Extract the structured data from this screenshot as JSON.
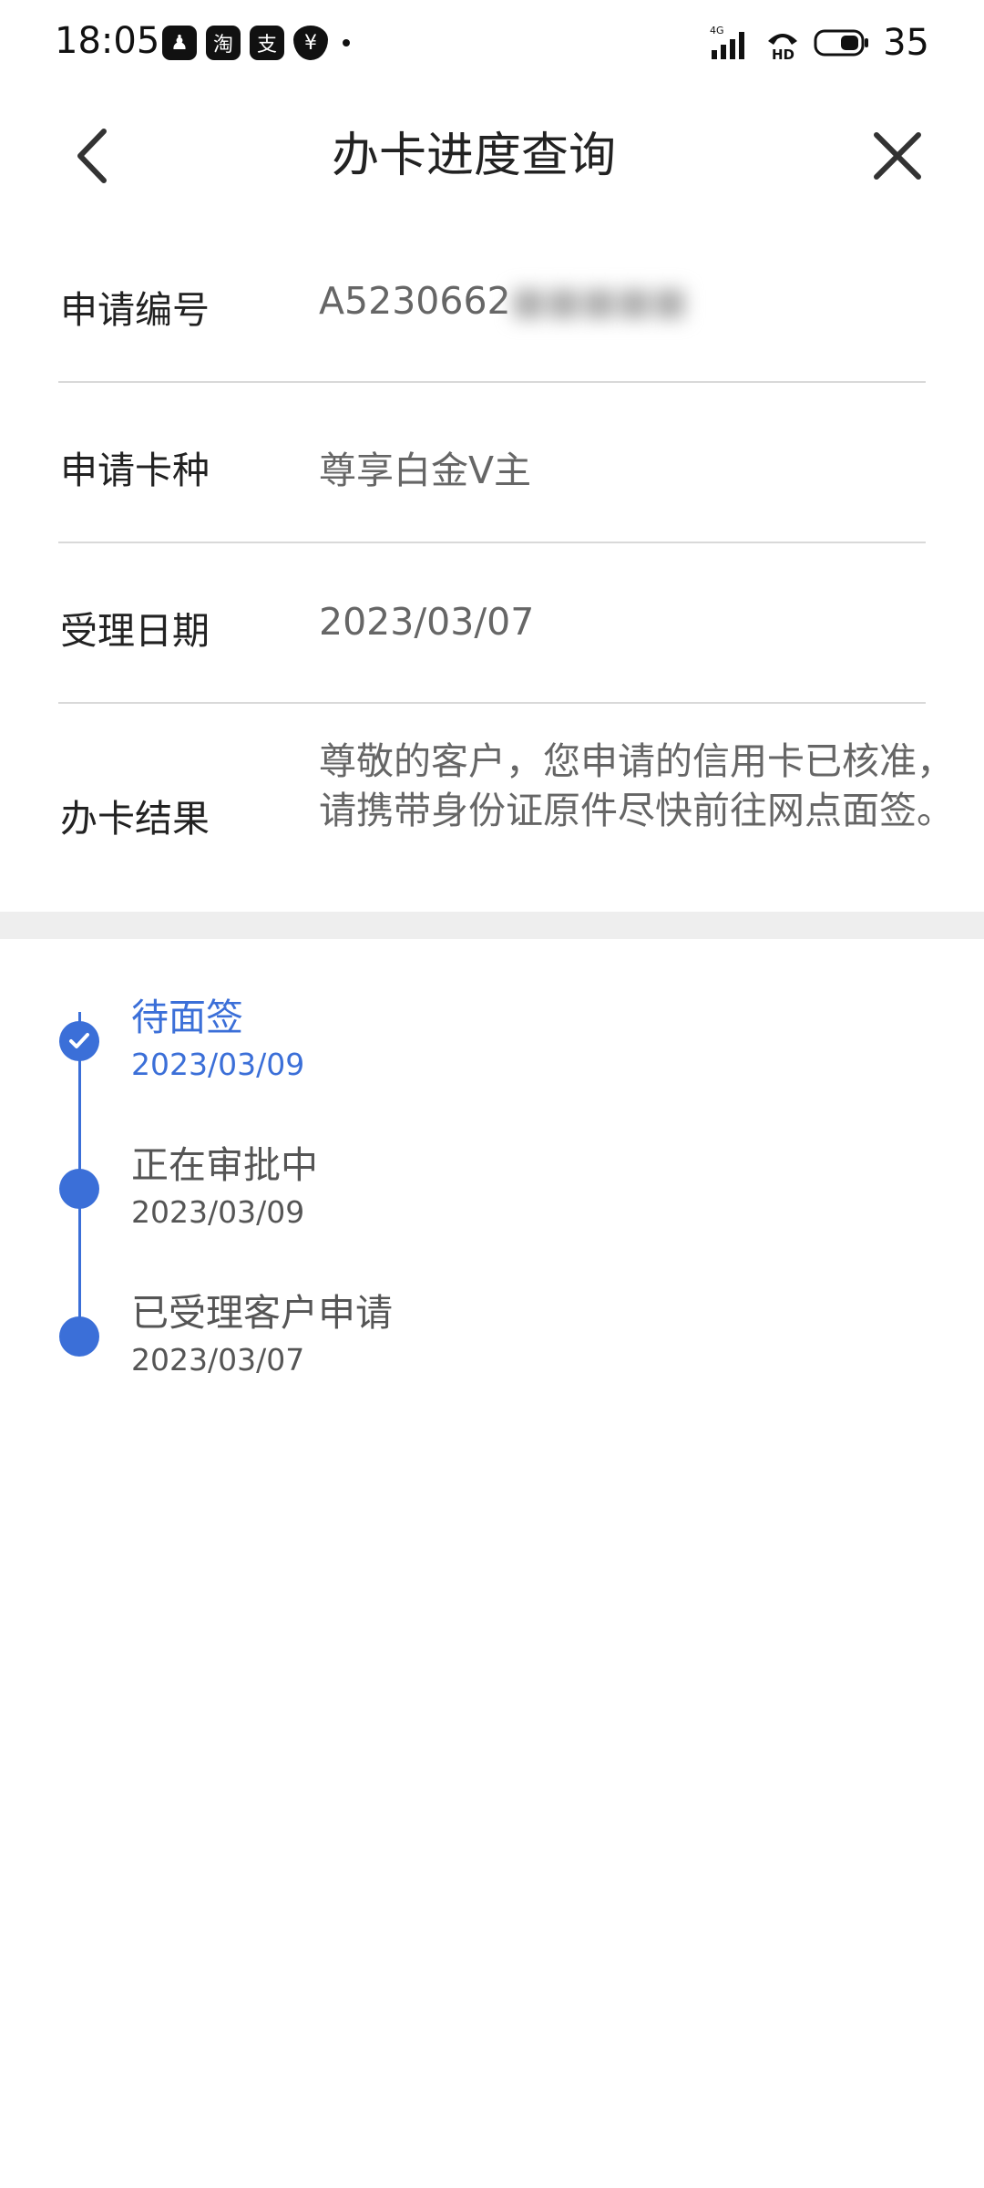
{
  "status_bar": {
    "time": "18:05",
    "apps": [
      {
        "icon": "qq-icon",
        "glyph": "♟"
      },
      {
        "icon": "taobao-icon",
        "glyph": "淘"
      },
      {
        "icon": "alipay-icon",
        "glyph": "支"
      },
      {
        "icon": "yen-shield-icon",
        "glyph": "¥"
      }
    ],
    "battery_level": "35",
    "network_label": "4G"
  },
  "nav": {
    "title": "办卡进度查询"
  },
  "info": {
    "application_no_label": "申请编号",
    "application_no_value": "A5230662",
    "card_type_label": "申请卡种",
    "card_type_value": "尊享白金V主",
    "accept_date_label": "受理日期",
    "accept_date_value": "2023/03/07",
    "result_label": "办卡结果",
    "result_value": "尊敬的客户，您申请的信用卡已核准，请携带身份证原件尽快前往网点面签。"
  },
  "timeline": [
    {
      "title": "待面签",
      "date": "2023/03/09",
      "active": true
    },
    {
      "title": "正在审批中",
      "date": "2023/03/09",
      "active": false
    },
    {
      "title": "已受理客户申请",
      "date": "2023/03/07",
      "active": false
    }
  ],
  "colors": {
    "accent": "#3b6fd8",
    "divider": "#d9d9d9",
    "band": "#eeeeee"
  }
}
